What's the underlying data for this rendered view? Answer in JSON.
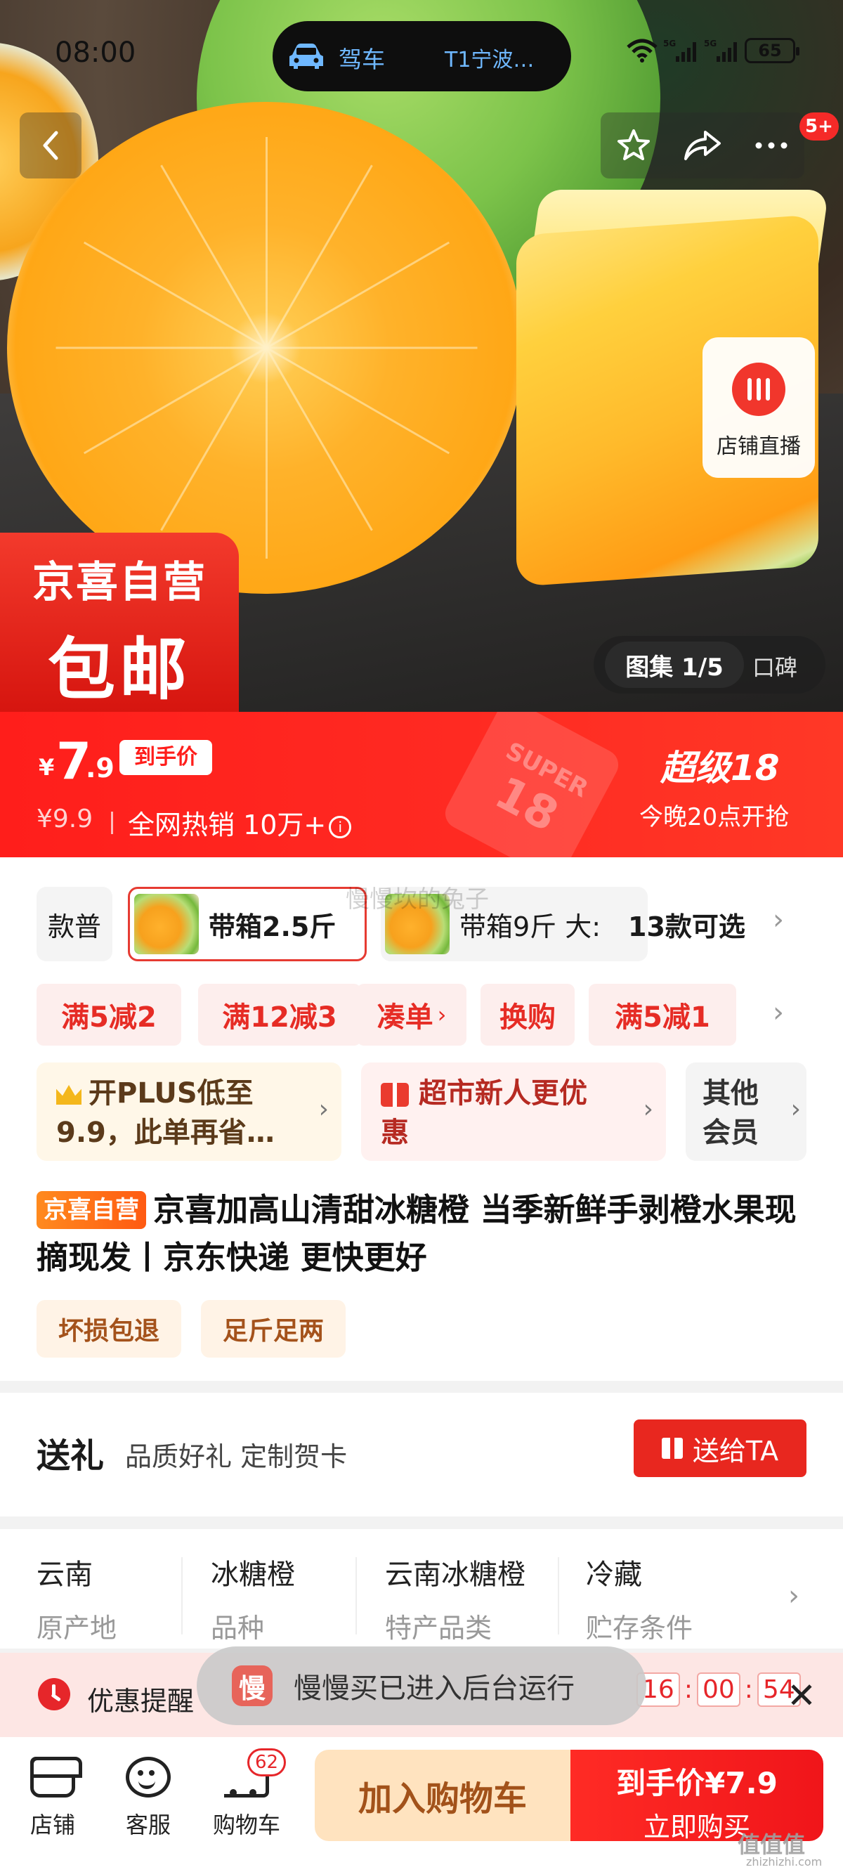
{
  "status_bar": {
    "time": "08:00",
    "nav_mode": "驾车",
    "nav_destination": "T1宁波…",
    "network": "5G",
    "battery": "65"
  },
  "hero": {
    "more_badge": "5+",
    "live_label": "店铺直播",
    "badge_line1": "京喜自营",
    "badge_line2": "包邮",
    "gallery_label": "图集 1/5",
    "reviews_label": "口碑"
  },
  "price": {
    "currency": "¥",
    "integer": "7",
    "decimal": ".9",
    "tag": "到手价",
    "original": "¥9.9",
    "sales": "全网热销 10万+",
    "super_tag_top": "SUPER",
    "super_tag_num": "18",
    "event_title": "超级18",
    "event_time": "今晚20点开抢"
  },
  "variants": {
    "items": [
      "款普",
      "带箱2.5斤",
      "带箱9斤 大:"
    ],
    "count_label": "13款可选",
    "overlay_user": "慢慢坎的兔子"
  },
  "promos": [
    "满5减2",
    "满12减3",
    "凑单",
    "换购",
    "满5减1"
  ],
  "members": [
    {
      "line1": "开PLUS低至",
      "line2": "9.9，此单再省…"
    },
    {
      "line1": "超市新人更优",
      "line2": "惠"
    },
    {
      "line1": "其他",
      "line2": "会员"
    }
  ],
  "product": {
    "store_tag": "京喜自营",
    "title": "京喜加高山清甜冰糖橙 当季新鲜手剥橙水果现摘现发丨京东快递 更快更好",
    "services": [
      "坏损包退",
      "足斤足两"
    ]
  },
  "gift": {
    "title": "送礼",
    "subtitle": "品质好礼 定制贺卡",
    "button": "送给TA"
  },
  "attributes": [
    {
      "value": "云南",
      "key": "原产地"
    },
    {
      "value": "冰糖橙",
      "key": "品种"
    },
    {
      "value": "云南冰糖橙",
      "key": "特产品类"
    },
    {
      "value": "冷藏",
      "key": "贮存条件"
    }
  ],
  "reminder": {
    "label": "优惠提醒",
    "hours": "16",
    "minutes": "00",
    "seconds": "54"
  },
  "toast": {
    "icon_char": "慢",
    "text": "慢慢买已进入后台运行"
  },
  "bottom_bar": {
    "shop": "店铺",
    "service": "客服",
    "cart": "购物车",
    "cart_count": "62",
    "add_to_cart": "加入购物车",
    "buy_price": "到手价¥7.9",
    "buy_now": "立即购买"
  },
  "watermark": {
    "brand": "值值值",
    "url": "zhizhizhi.com"
  },
  "colors": {
    "accent_red": "#ff1e1b",
    "promo_red": "#e62c25",
    "gold": "#a2521a"
  }
}
